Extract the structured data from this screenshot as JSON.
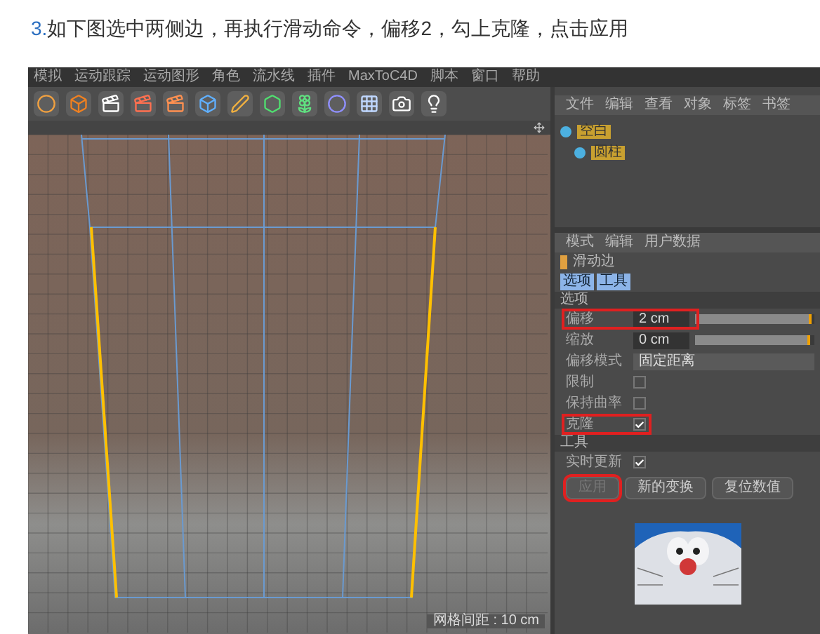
{
  "heading": {
    "number": "3.",
    "text": "如下图选中两侧边，再执行滑动命令，偏移2，勾上克隆，点击应用"
  },
  "menu_bar": [
    "模拟",
    "运动跟踪",
    "运动图形",
    "角色",
    "流水线",
    "插件",
    "MaxToC4D",
    "脚本",
    "窗口",
    "帮助"
  ],
  "viewport": {
    "grid_label": "网格间距 : 10 cm"
  },
  "object_manager": {
    "menu": [
      "文件",
      "编辑",
      "查看",
      "对象",
      "标签",
      "书签"
    ],
    "objects": [
      {
        "name": "空白",
        "children": [
          {
            "name": "圆柱"
          }
        ]
      }
    ]
  },
  "attributes": {
    "menu": [
      "模式",
      "编辑",
      "用户数据"
    ],
    "tool_name": "滑动边",
    "tabs": [
      {
        "label": "选项",
        "selected": true
      },
      {
        "label": "工具",
        "selected": true
      }
    ],
    "sections": [
      {
        "title": "选项",
        "rows": [
          {
            "kind": "number",
            "label": "偏移",
            "value": "2 cm",
            "level": 0.98,
            "highlighted": true
          },
          {
            "kind": "number",
            "label": "缩放",
            "value": "0 cm",
            "level": 0.97,
            "highlighted": false
          },
          {
            "kind": "select",
            "label": "偏移模式",
            "value": "固定距离",
            "highlighted": false
          },
          {
            "kind": "checkbox",
            "label": "限制",
            "checked": false,
            "highlighted": false
          },
          {
            "kind": "checkbox",
            "label": "保持曲率",
            "checked": false,
            "highlighted": false
          },
          {
            "kind": "checkbox",
            "label": "克隆",
            "checked": true,
            "highlighted": true
          }
        ]
      },
      {
        "title": "工具",
        "rows": [
          {
            "kind": "checkbox",
            "label": "实时更新",
            "checked": true,
            "highlighted": false
          }
        ],
        "buttons": [
          {
            "label": "应用",
            "disabled": true,
            "highlighted": true
          },
          {
            "label": "新的变换",
            "disabled": false,
            "highlighted": false
          },
          {
            "label": "复位数值",
            "disabled": false,
            "highlighted": false
          }
        ]
      }
    ]
  }
}
